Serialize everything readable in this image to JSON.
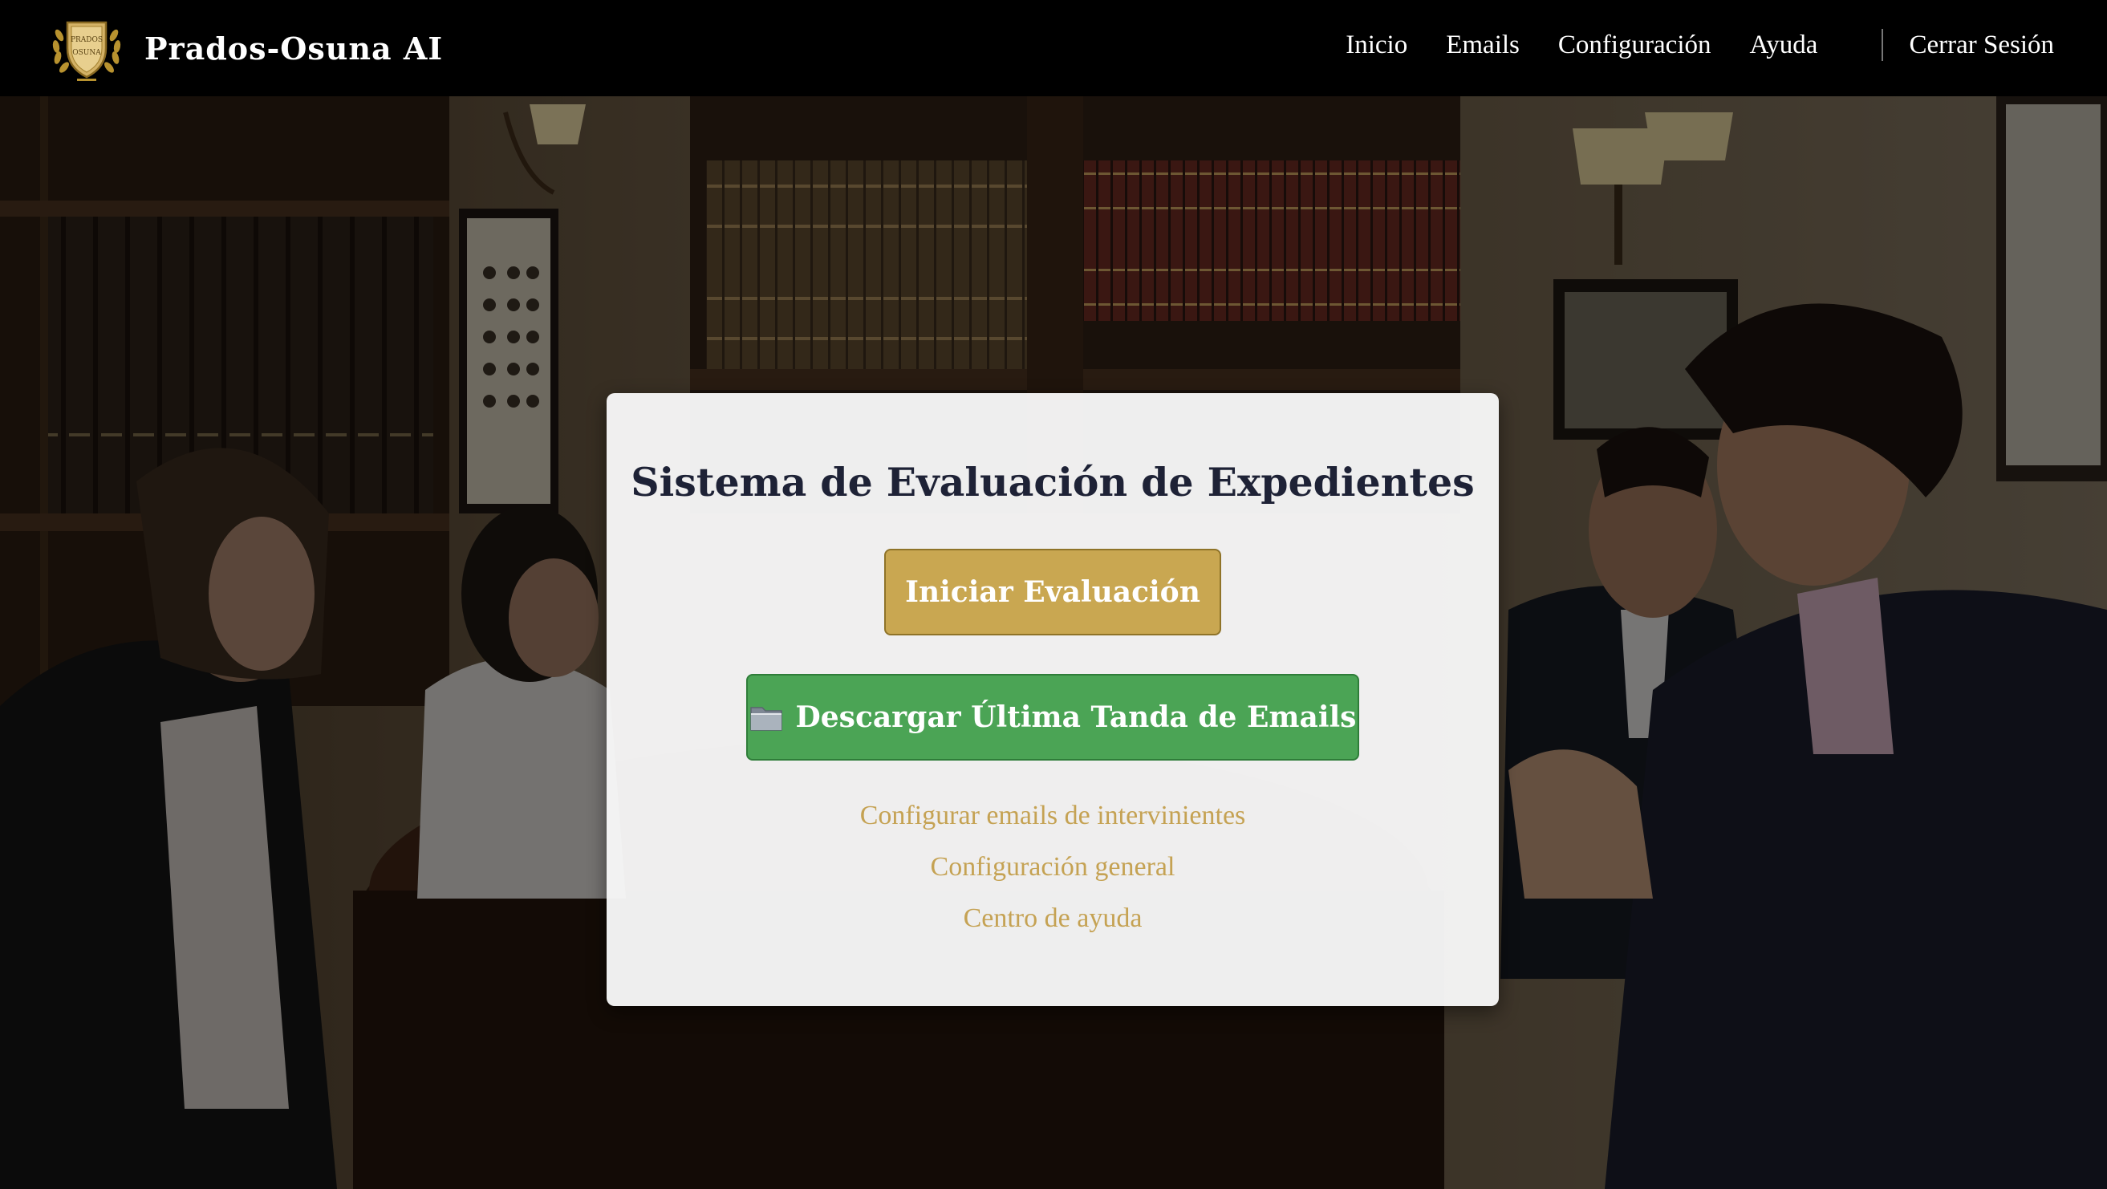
{
  "brand": {
    "name": "Prados-Osuna AI",
    "logo_icon": "law-firm-crest-logo",
    "logo_text_top": "PRADOS",
    "logo_text_bottom": "OSUNA"
  },
  "nav": {
    "items": [
      {
        "label": "Inicio"
      },
      {
        "label": "Emails"
      },
      {
        "label": "Configuración"
      },
      {
        "label": "Ayuda"
      }
    ],
    "logout_label": "Cerrar Sesión"
  },
  "card": {
    "title": "Sistema de Evaluación de Expedientes",
    "start_button": "Iniciar Evaluación",
    "download_button": {
      "icon": "folder-icon",
      "label": "Descargar Última Tanda de Emails"
    },
    "links": [
      {
        "label": "Configurar emails de intervinientes"
      },
      {
        "label": "Configuración general"
      },
      {
        "label": "Centro de ayuda"
      }
    ]
  },
  "colors": {
    "navbar_bg": "#000000",
    "accent_gold": "#c9a751",
    "link_gold": "#c5a253",
    "download_green": "#4ba455",
    "title_navy": "#1e2236"
  }
}
